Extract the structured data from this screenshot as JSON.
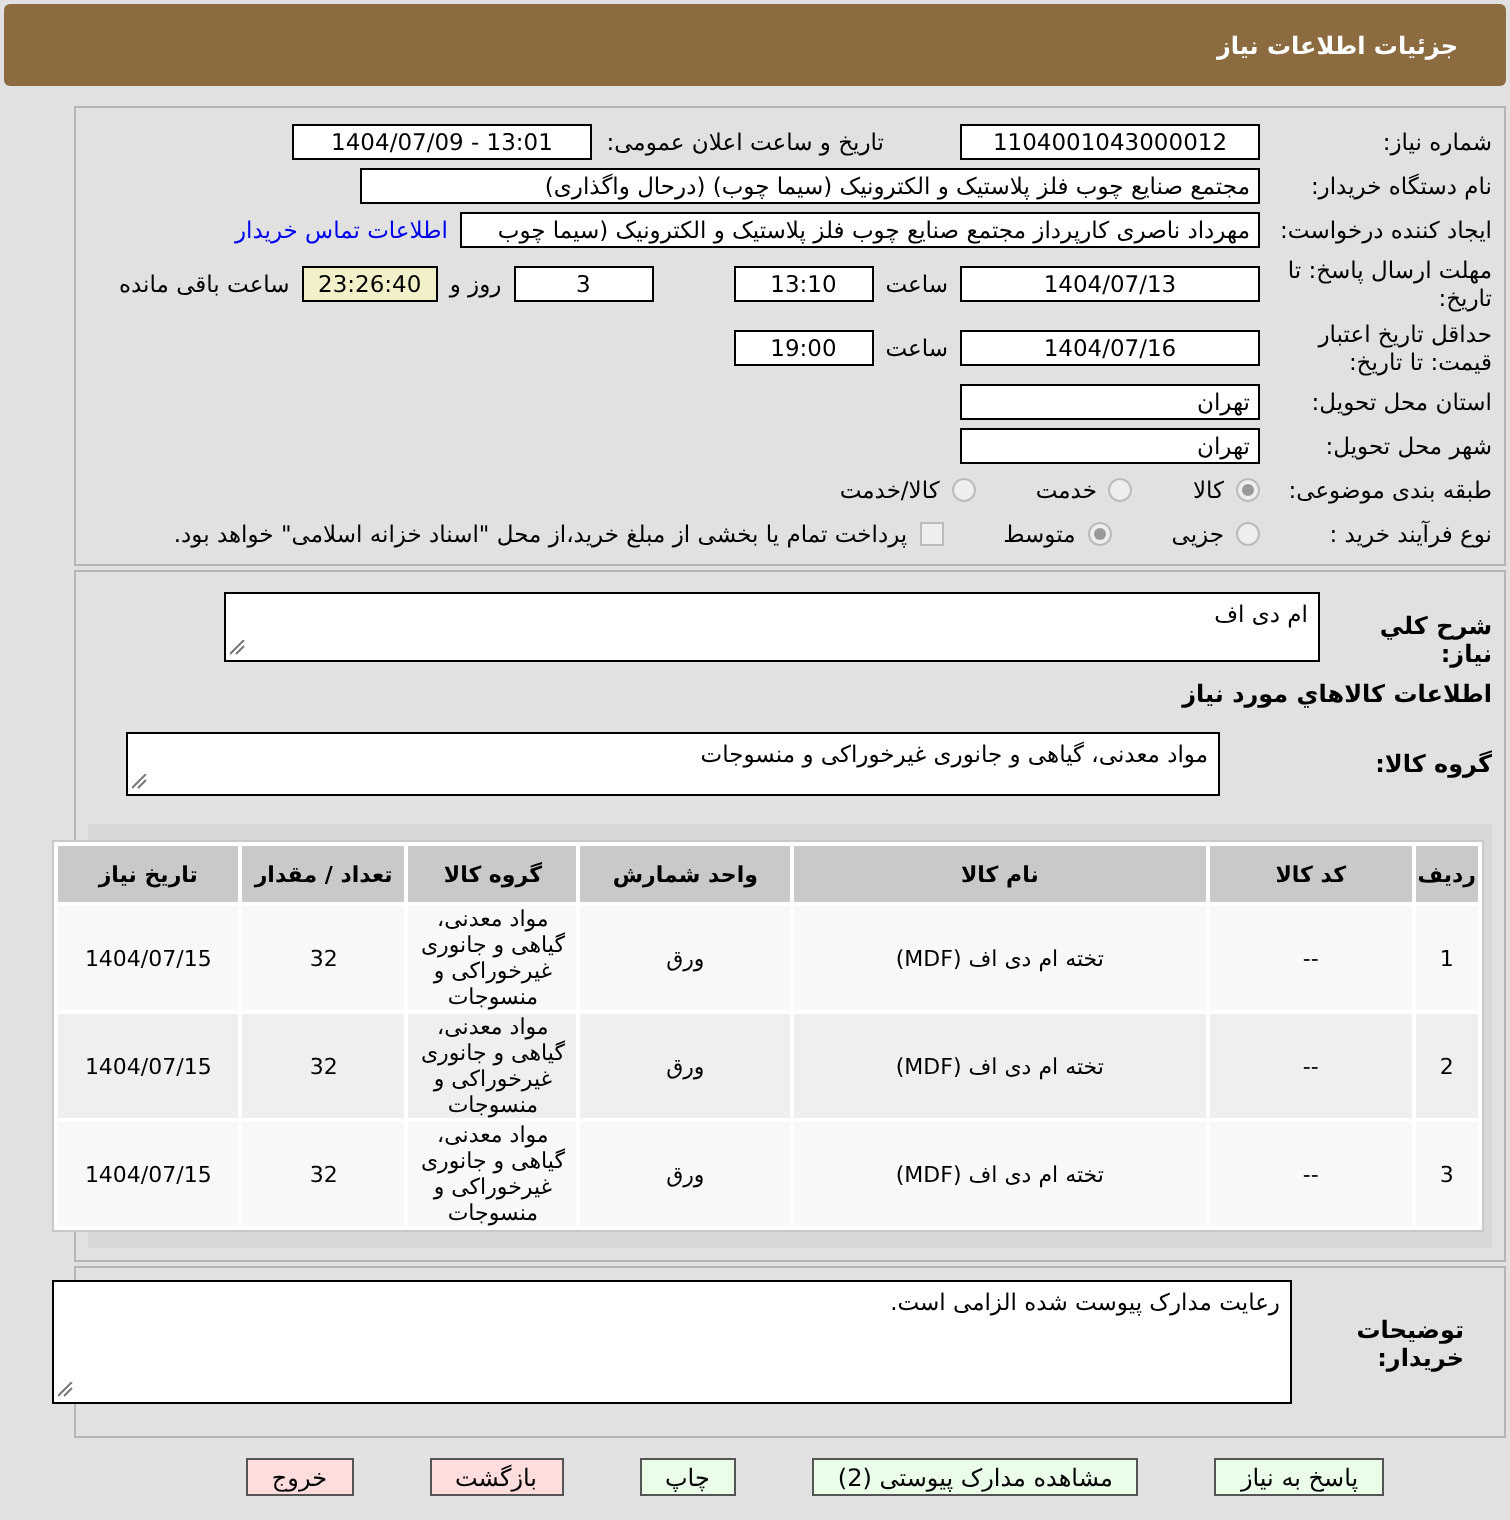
{
  "header": {
    "title": "جزئیات اطلاعات نیاز"
  },
  "need_number": {
    "label": "شماره نیاز:",
    "value": "1104001043000012"
  },
  "announce_date": {
    "label": "تاریخ و ساعت اعلان عمومی:",
    "value": "1404/07/09 - 13:01"
  },
  "buyer_org": {
    "label": "نام دستگاه خریدار:",
    "value": "مجتمع  صنایع چوب  فلز  پلاستیک و الکترونیک (سیما چوب) (درحال واگذاری)"
  },
  "requester": {
    "label": "ایجاد کننده درخواست:",
    "value": "مهرداد ناصری کارپرداز مجتمع  صنایع چوب  فلز  پلاستیک و الکترونیک (سیما چوب",
    "link": "اطلاعات تماس خریدار"
  },
  "deadline": {
    "label": "مهلت ارسال پاسخ: تا تاریخ:",
    "date": "1404/07/13",
    "time_label": "ساعت",
    "time": "13:10",
    "days": "3",
    "days_label": "روز و",
    "remaining": "23:26:40",
    "remaining_label": "ساعت باقی مانده"
  },
  "validity": {
    "label": "حداقل تاریخ اعتبار قیمت: تا تاریخ:",
    "date": "1404/07/16",
    "time_label": "ساعت",
    "time": "19:00"
  },
  "province": {
    "label": "استان محل تحویل:",
    "value": "تهران"
  },
  "city": {
    "label": "شهر محل تحویل:",
    "value": "تهران"
  },
  "category": {
    "label": "طبقه بندی موضوعی:",
    "options": [
      {
        "label": "کالا",
        "selected": true
      },
      {
        "label": "خدمت",
        "selected": false
      },
      {
        "label": "کالا/خدمت",
        "selected": false
      }
    ]
  },
  "process": {
    "label": "نوع فرآیند خرید :",
    "options": [
      {
        "label": "جزیی",
        "selected": false
      },
      {
        "label": "متوسط",
        "selected": true
      }
    ],
    "treasury": {
      "checked": false,
      "label": "پرداخت تمام یا بخشی از مبلغ خرید،از محل \"اسناد خزانه اسلامی\" خواهد بود."
    }
  },
  "description": {
    "label": "شرح كلي نياز:",
    "value": "ام دی اف"
  },
  "goods_title": "اطلاعات كالاهاي مورد نياز",
  "goods_group": {
    "label": "گروه کالا:",
    "value": "مواد معدنی، گیاهی و جانوری غیرخوراکی و منسوجات"
  },
  "table": {
    "columns": [
      "ردیف",
      "کد کالا",
      "نام کالا",
      "واحد شمارش",
      "گروه کالا",
      "تعداد / مقدار",
      "تاریخ نیاز"
    ],
    "rows": [
      [
        "1",
        "--",
        "تخته ام دی اف (MDF)",
        "ورق",
        "مواد معدنی، گیاهی و جانوری غیرخوراکی و منسوجات",
        "32",
        "1404/07/15"
      ],
      [
        "2",
        "--",
        "تخته ام دی اف (MDF)",
        "ورق",
        "مواد معدنی، گیاهی و جانوری غیرخوراکی و منسوجات",
        "32",
        "1404/07/15"
      ],
      [
        "3",
        "--",
        "تخته ام دی اف (MDF)",
        "ورق",
        "مواد معدنی، گیاهی و جانوری غیرخوراکی و منسوجات",
        "32",
        "1404/07/15"
      ]
    ]
  },
  "buyer_notes": {
    "label": "توضیحات خریدار:",
    "value": "رعایت مدارک پیوست شده الزامی است."
  },
  "buttons": [
    {
      "label": "پاسخ به نیاز",
      "kind": "action"
    },
    {
      "label": "مشاهده مدارک پیوستی (2)",
      "kind": "action"
    },
    {
      "label": "چاپ",
      "kind": "action"
    },
    {
      "label": "بازگشت",
      "kind": "exit"
    },
    {
      "label": "خروج",
      "kind": "exit"
    }
  ]
}
